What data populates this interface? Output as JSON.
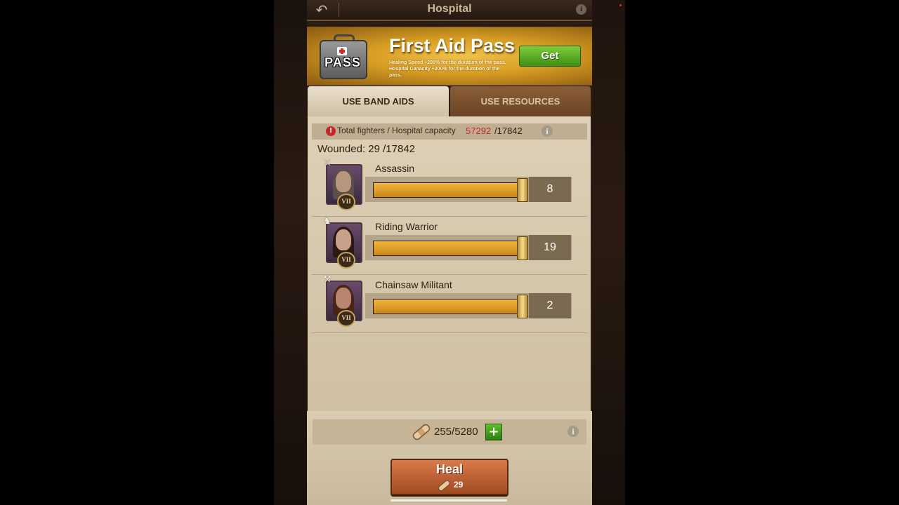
{
  "header": {
    "title": "Hospital",
    "back_icon": "back-arrow-icon",
    "info_icon": "info-icon"
  },
  "banner": {
    "title": "First Aid Pass",
    "pass_word": "PASS",
    "line1": "Healing Speed +200% for the duration of the pass.",
    "line2": "Hospital Capacity +200% for the duration of the",
    "line3": "pass.",
    "get_label": "Get"
  },
  "tabs": [
    {
      "label": "USE BAND AIDS",
      "active": true
    },
    {
      "label": "USE RESOURCES",
      "active": false
    }
  ],
  "capacity": {
    "label": "Total fighters / Hospital capacity",
    "total": "57292",
    "capacity": "/17842",
    "total_color": "#c62828"
  },
  "wounded": "Wounded: 29 /17842",
  "units": [
    {
      "name": "Assassin",
      "count": "8",
      "rank": "VII",
      "fill_fraction": 1.0,
      "type_icon": "dagger-icon"
    },
    {
      "name": "Riding Warrior",
      "count": "19",
      "rank": "VII",
      "fill_fraction": 1.0,
      "type_icon": "horse-icon"
    },
    {
      "name": "Chainsaw Militant",
      "count": "2",
      "rank": "VII",
      "fill_fraction": 1.0,
      "type_icon": "chainsaw-icon"
    }
  ],
  "bandages": {
    "count": "255/5280",
    "plus": "+"
  },
  "heal": {
    "label": "Heal",
    "cost": "29"
  }
}
